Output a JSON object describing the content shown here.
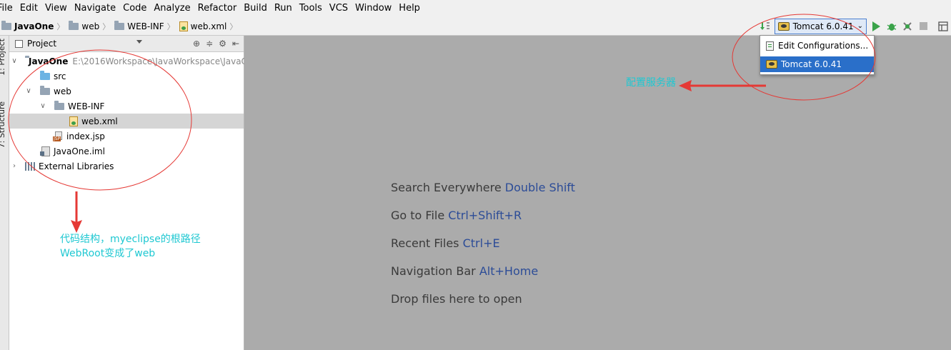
{
  "menu": [
    "File",
    "Edit",
    "View",
    "Navigate",
    "Code",
    "Analyze",
    "Refactor",
    "Build",
    "Run",
    "Tools",
    "VCS",
    "Window",
    "Help"
  ],
  "breadcrumb": [
    "JavaOne",
    "web",
    "WEB-INF",
    "web.xml"
  ],
  "run_config": {
    "selected": "Tomcat 6.0.41"
  },
  "popup": {
    "items": [
      "Edit Configurations...",
      "Tomcat 6.0.41"
    ]
  },
  "side_tabs": {
    "project": "1: Project",
    "structure": "7: Structure"
  },
  "panel": {
    "title": "Project",
    "tree": [
      {
        "label": "JavaOne",
        "path": "E:\\2016Workspace\\JavaWorkspace\\JavaOne"
      },
      {
        "label": "src"
      },
      {
        "label": "web"
      },
      {
        "label": "WEB-INF"
      },
      {
        "label": "web.xml"
      },
      {
        "label": "index.jsp"
      },
      {
        "label": "JavaOne.iml"
      },
      {
        "label": "External Libraries"
      }
    ]
  },
  "hints": [
    {
      "text": "Search Everywhere",
      "key": "Double Shift"
    },
    {
      "text": "Go to File",
      "key": "Ctrl+Shift+R"
    },
    {
      "text": "Recent Files",
      "key": "Ctrl+E"
    },
    {
      "text": "Navigation Bar",
      "key": "Alt+Home"
    },
    {
      "text": "Drop files here to open",
      "key": ""
    }
  ],
  "annotations": {
    "server": "配置服务器",
    "code_line1": "代码结构，myeclipse的根路径",
    "code_line2": "WebRoot变成了web"
  },
  "colors": {
    "annotation": "#1fc8d2",
    "circle": "#e53935",
    "selection": "#2a6fc9",
    "key": "#2c4c97"
  }
}
